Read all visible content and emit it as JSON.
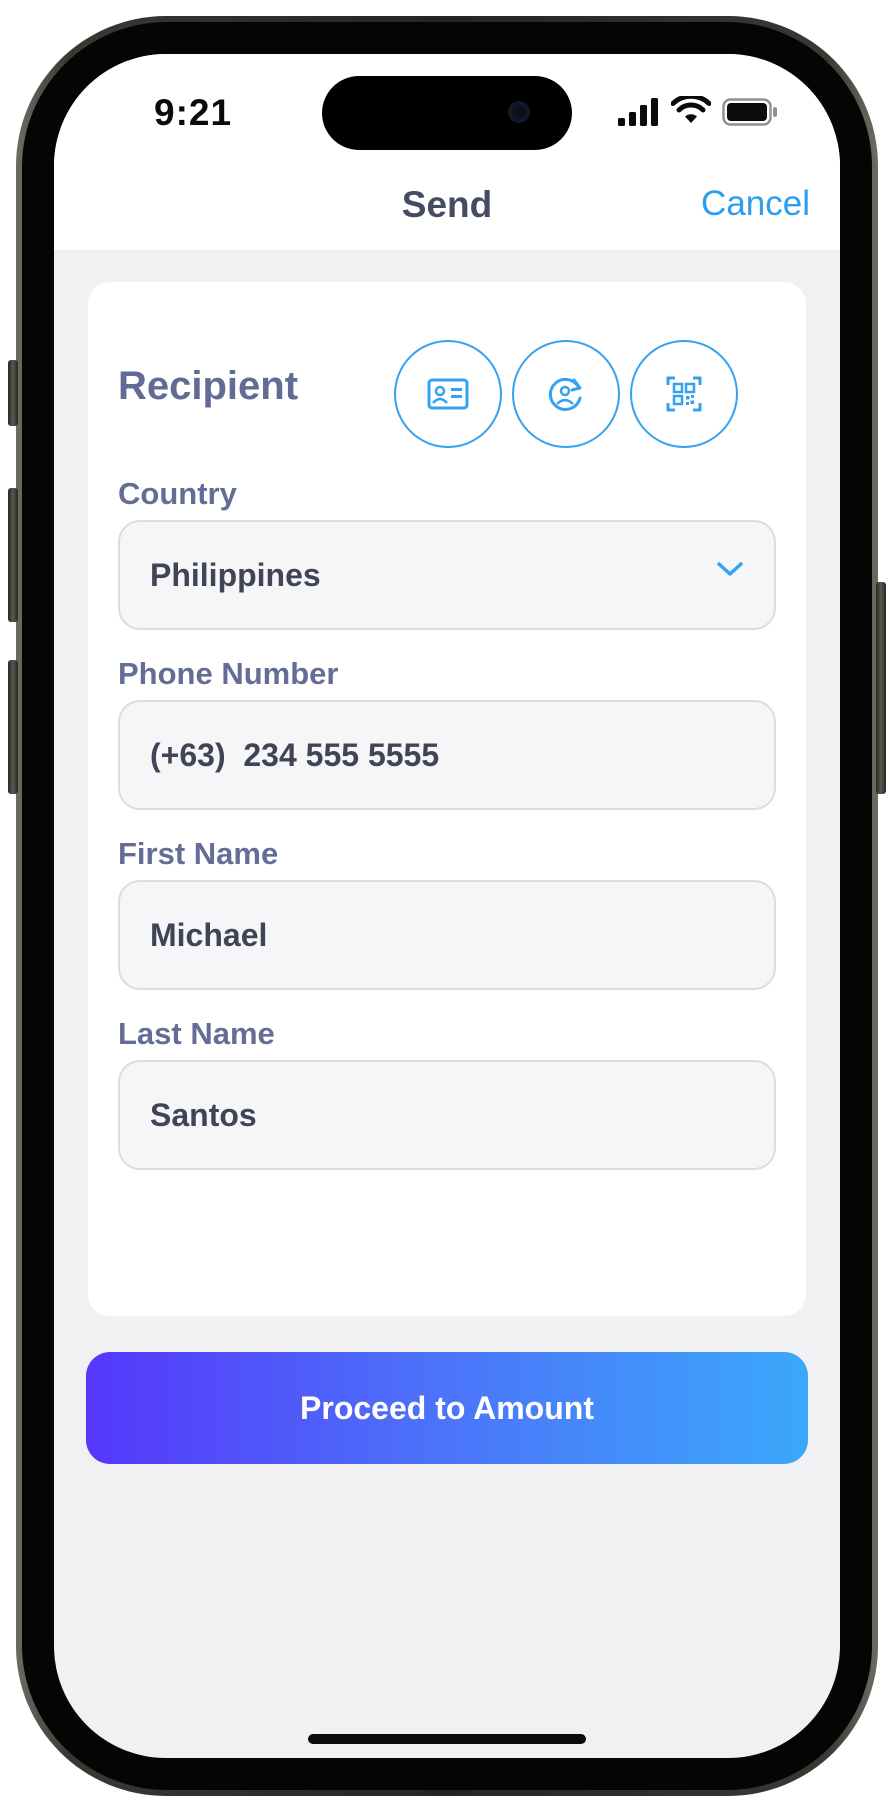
{
  "status_bar": {
    "time": "9:21"
  },
  "nav": {
    "title": "Send",
    "cancel_label": "Cancel"
  },
  "recipient": {
    "heading": "Recipient",
    "actions": [
      "contact-card-icon",
      "recent-contacts-icon",
      "qr-code-icon"
    ]
  },
  "form": {
    "country": {
      "label": "Country",
      "value": "Philippines"
    },
    "phone": {
      "label": "Phone Number",
      "value": "(+63)  234 555 5555"
    },
    "first_name": {
      "label": "First Name",
      "value": "Michael"
    },
    "last_name": {
      "label": "Last Name",
      "value": "Santos"
    }
  },
  "cta": {
    "label": "Proceed to Amount"
  },
  "colors": {
    "accent": "#2c9eee",
    "gradient_start": "#5537fb",
    "gradient_end": "#3ba8fb",
    "label": "#646d95"
  }
}
